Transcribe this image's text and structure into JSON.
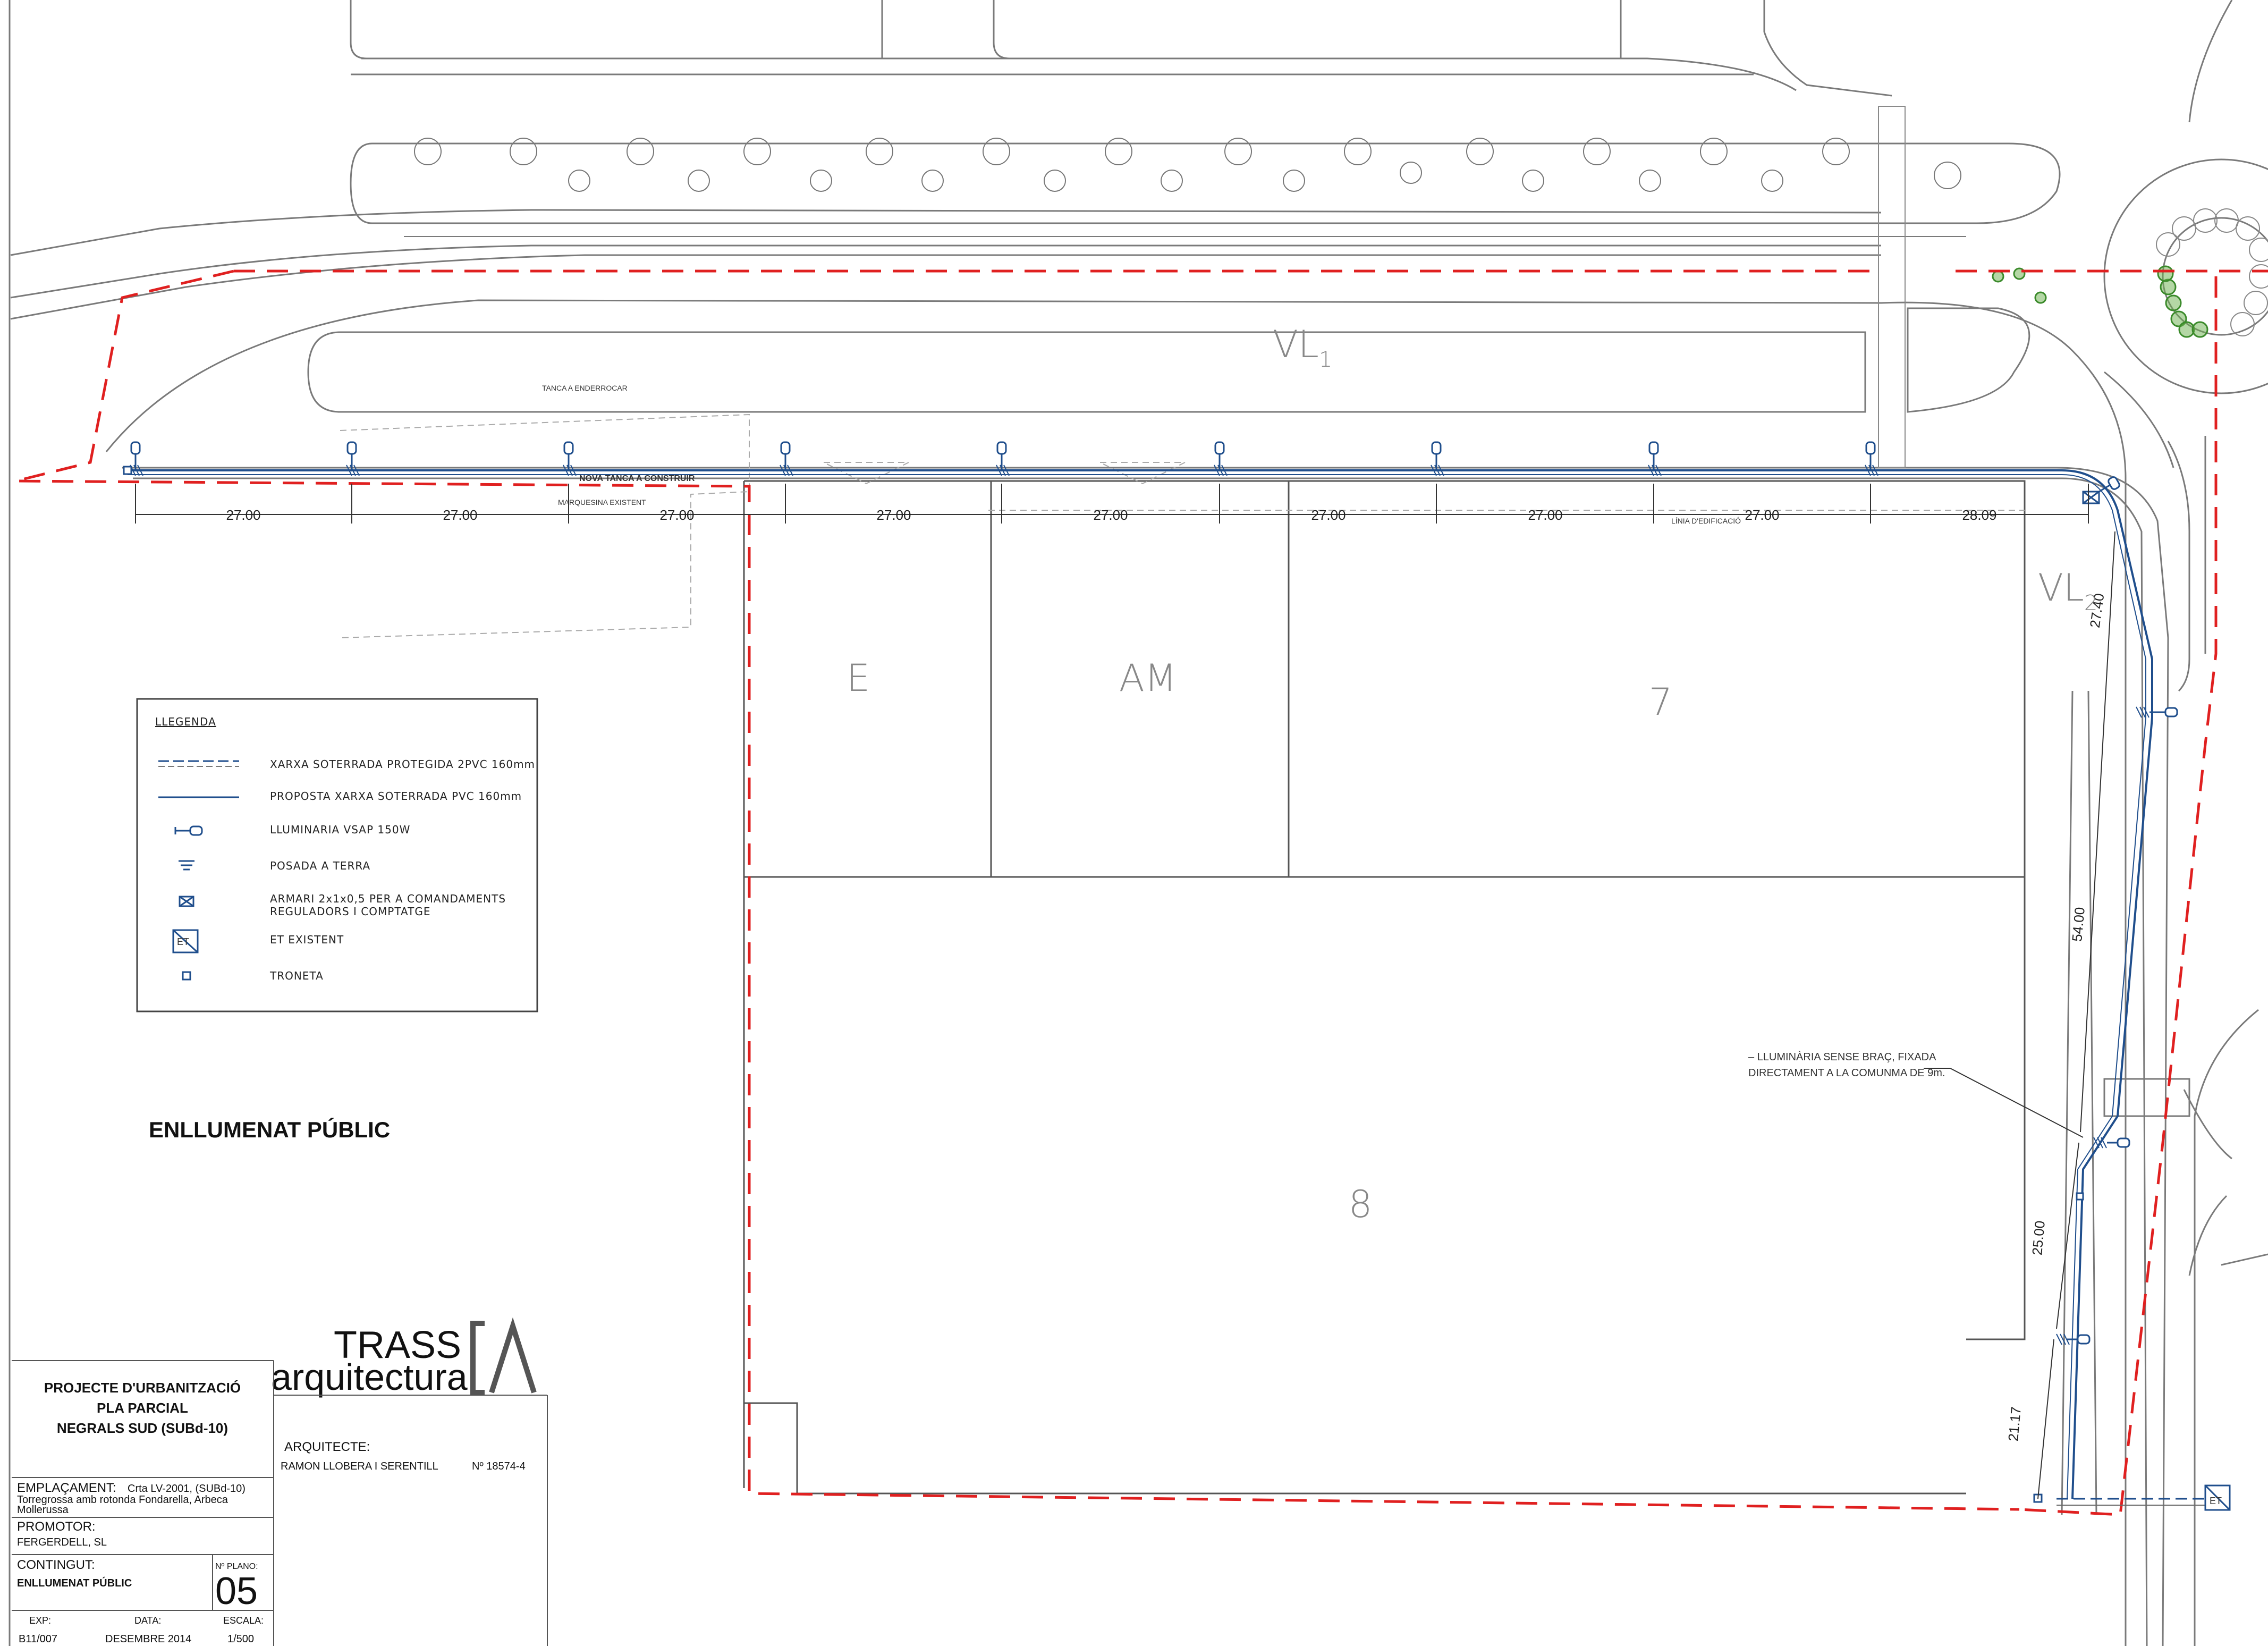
{
  "drawing_title": "ENLLUMENAT PÚBLIC",
  "zones": {
    "vl1": "VL",
    "vl1_sub": "1",
    "vl2": "VL",
    "vl2_sub": "2",
    "lot_e": "E",
    "lot_am": "AM",
    "lot_7": "7",
    "lot_8": "8"
  },
  "annotations": {
    "nova_tanca": "NOVA TANCA A CONSTRUIR",
    "tanca_enderrocar": "TANCA A ENDERROCAR",
    "marquesina": "MARQUESINA EXISTENT",
    "linia_edificacio": "LÍNIA D'EDIFICACIÓ",
    "note_line1": "– LLUMINÀRIA SENSE BRAÇ, FIXADA",
    "note_line2": "DIRECTAMENT A LA COMUNMA DE 9m."
  },
  "dimensions": {
    "horizontal": [
      "27.00",
      "27.00",
      "27.00",
      "27.00",
      "27.00",
      "27.00",
      "27.00",
      "27.00",
      "28.09"
    ],
    "vertical": [
      "27.40",
      "54.00",
      "25.00",
      "21.17"
    ]
  },
  "legend": {
    "title": "LLEGENDA",
    "items": [
      "XARXA SOTERRADA PROTEGIDA 2PVC 160mm",
      "PROPOSTA XARXA SOTERRADA PVC 160mm",
      "LLUMINARIA VSAP 150W",
      "POSADA A TERRA",
      "ARMARI 2x1x0,5 PER A COMANDAMENTS",
      "REGULADORS I COMPTATGE",
      "ET EXISTENT",
      "TRONETA"
    ],
    "et_symbol": "ET"
  },
  "logo": {
    "brand_top": "TRASS",
    "brand_bottom": "arquitectura"
  },
  "title_block": {
    "project_line1": "PROJECTE D'URBANITZACIÓ",
    "project_line2": "PLA PARCIAL",
    "project_line3": "NEGRALS SUD (SUBd-10)",
    "arquitecte_label": "ARQUITECTE:",
    "arquitecte_name": "RAMON LLOBERA I SERENTILL",
    "colegiat": "Nº 18574-4",
    "emplacament_label": "EMPLAÇAMENT:",
    "emplacament_value1": "Crta LV-2001, (SUBd-10)",
    "emplacament_value2": "Torregrossa amb rotonda Fondarella, Arbeca",
    "emplacament_value3": "Mollerussa",
    "promotor_label": "PROMOTOR:",
    "promotor_value": "FERGERDELL, SL",
    "contingut_label": "CONTINGUT:",
    "contingut_value": "ENLLUMENAT PÚBLIC",
    "plano_label": "Nº PLANO:",
    "plano_value": "05",
    "exp_label": "EXP:",
    "exp_value": "B11/007",
    "data_label": "DATA:",
    "data_value": "DESEMBRE 2014",
    "escala_label": "ESCALA:",
    "escala_value": "1/500"
  },
  "colors": {
    "boundary": "#e02020",
    "network": "#1f4e8c",
    "logo_red": "#c0401c",
    "linework": "#6a6a6a",
    "trees": "#3a8a2a"
  }
}
